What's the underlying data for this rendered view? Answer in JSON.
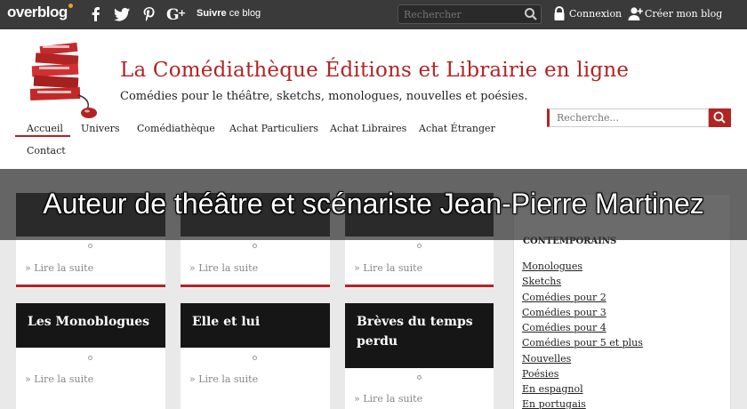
{
  "topbar": {
    "logo": "overblog",
    "social_icons": [
      "facebook-icon",
      "twitter-icon",
      "pinterest-icon",
      "googleplus-icon"
    ],
    "follow_bold": "Suivre",
    "follow_rest": "ce blog",
    "search_placeholder": "Rechercher",
    "login_label": "Connexion",
    "create_label": "Créer mon blog"
  },
  "header": {
    "title": "La Comédiathèque Éditions et Librairie en ligne",
    "subtitle": "Comédies pour le théâtre, sketchs, monologues, nouvelles et poésies."
  },
  "nav": {
    "items": [
      {
        "label": "Accueil",
        "active": true
      },
      {
        "label": "Univers"
      },
      {
        "label": "Comédiathèque"
      },
      {
        "label": "Achat Particuliers"
      },
      {
        "label": "Achat Libraires"
      },
      {
        "label": "Achat Étranger"
      },
      {
        "label": "Contact"
      }
    ],
    "search_placeholder": "Recherche..."
  },
  "banner": {
    "text": "Auteur de théâtre et scénariste Jean-Pierre Martinez"
  },
  "cards": [
    {
      "title": "",
      "more": "Lire la suite"
    },
    {
      "title": "",
      "more": "Lire la suite"
    },
    {
      "title": "",
      "more": "Lire la suite"
    },
    {
      "title": "Les Monoblogues",
      "more": "Lire la suite"
    },
    {
      "title": "Elle et lui",
      "more": "Lire la suite"
    },
    {
      "title": "Brèves du temps perdu",
      "more": "Lire la suite"
    }
  ],
  "sidebar": {
    "heading": "CONTEMPORAINS",
    "items": [
      "Monologues",
      "Sketchs",
      "Comédies pour 2",
      "Comédies pour 3",
      "Comédies pour 4",
      "Comédies pour 5 et plus",
      "Nouvelles",
      "Poésies",
      "En espagnol",
      "En portugais"
    ]
  },
  "colors": {
    "accent": "#b22424",
    "topbar": "#3a3a3a",
    "card_head": "#161616"
  }
}
